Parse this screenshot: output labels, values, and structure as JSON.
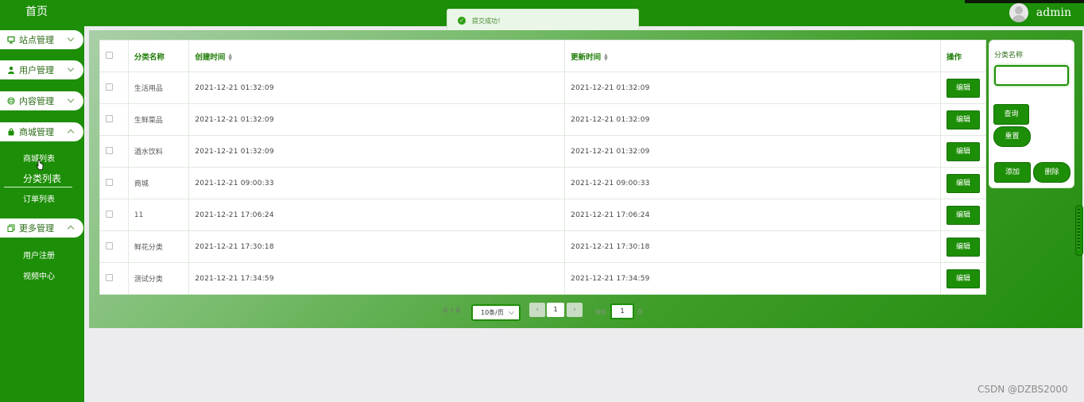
{
  "header": {
    "username": "admin"
  },
  "sidebar": {
    "brand": "首页",
    "groups": [
      {
        "label": "站点管理",
        "icon": "monitor-icon"
      },
      {
        "label": "用户管理",
        "icon": "user-icon"
      },
      {
        "label": "内容管理",
        "icon": "content-icon"
      },
      {
        "label": "商城管理",
        "icon": "bag-icon"
      },
      {
        "label": "更多管理",
        "icon": "copy-icon"
      }
    ],
    "mall_items": [
      "商城列表",
      "分类列表",
      "订单列表"
    ],
    "more_items": [
      "用户注册",
      "视频中心"
    ]
  },
  "toast": {
    "message": "提交成功！"
  },
  "table": {
    "headers": {
      "name": "分类名称",
      "created": "创建时间",
      "updated": "更新时间",
      "action": "操作"
    },
    "edit_label": "编辑",
    "rows": [
      {
        "name": "生活用品",
        "created": "2021-12-21 01:32:09",
        "updated": "2021-12-21 01:32:09"
      },
      {
        "name": "生鲜菜品",
        "created": "2021-12-21 01:32:09",
        "updated": "2021-12-21 01:32:09"
      },
      {
        "name": "酒水饮料",
        "created": "2021-12-21 01:32:09",
        "updated": "2021-12-21 01:32:09"
      },
      {
        "name": "商城",
        "created": "2021-12-21 09:00:33",
        "updated": "2021-12-21 09:00:33"
      },
      {
        "name": "11",
        "created": "2021-12-21 17:06:24",
        "updated": "2021-12-21 17:06:24"
      },
      {
        "name": "鲜花分类",
        "created": "2021-12-21 17:30:18",
        "updated": "2021-12-21 17:30:18"
      },
      {
        "name": "测试分类",
        "created": "2021-12-21 17:34:59",
        "updated": "2021-12-21 17:34:59"
      }
    ]
  },
  "search": {
    "label": "分类名称",
    "query": "查询",
    "reset": "重置",
    "add": "添加",
    "delete": "删除"
  },
  "pagination": {
    "total": "共 7 条",
    "page_size": "10条/页",
    "current_page": "1",
    "goto_prefix": "前往",
    "goto_value": "1",
    "goto_suffix": "页"
  },
  "watermark": "CSDN @DZBS2000",
  "colors": {
    "primary": "#1d8e07",
    "header_text": "#1f7d08"
  }
}
